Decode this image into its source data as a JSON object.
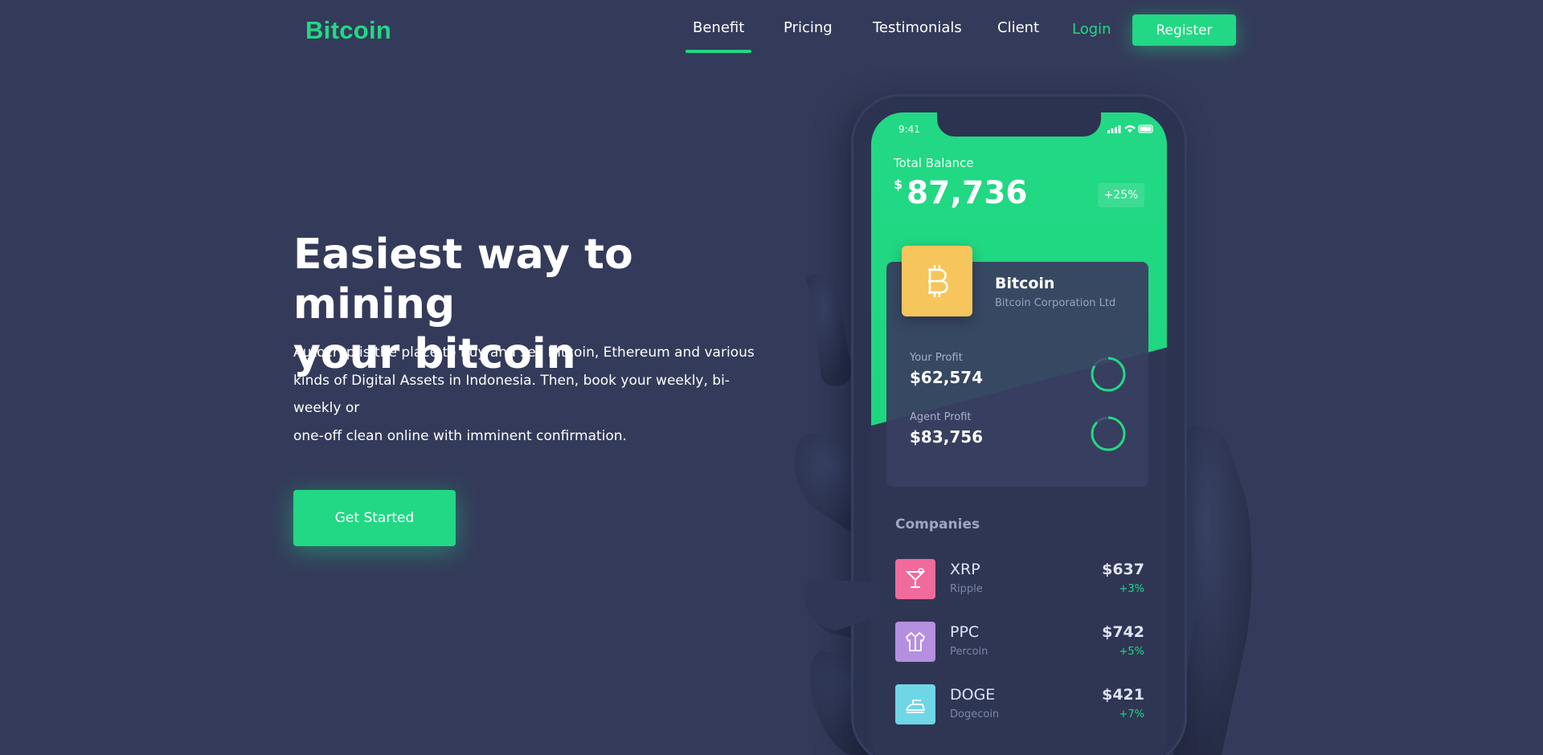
{
  "brand": {
    "logo_text": "Bitcoin",
    "accent": "#22d884",
    "background": "#343b5a"
  },
  "nav": {
    "links": [
      {
        "label": "Benefit",
        "active": true
      },
      {
        "label": "Pricing",
        "active": false
      },
      {
        "label": "Testimonials",
        "active": false
      },
      {
        "label": "Client",
        "active": false
      }
    ],
    "login_label": "Login",
    "register_label": "Register"
  },
  "hero": {
    "title_line1": "Easiest way to mining",
    "title_line2": "your bitcoin",
    "description_line1": "Autocryp is the place to buy and sell Bitcoin, Ethereum and various",
    "description_line2": "kinds of Digital Assets in Indonesia. Then, book your weekly, bi-weekly or",
    "description_line3": "one-off clean online with imminent confirmation.",
    "cta_label": "Get Started"
  },
  "phone": {
    "status_time": "9:41",
    "total_balance_label": "Total Balance",
    "currency_symbol": "$",
    "total_balance_value": "87,736",
    "balance_change": "+25%",
    "coin": {
      "name": "Bitcoin",
      "company": "Bitcoin Corporation Ltd",
      "icon": "bitcoin-icon",
      "color": "#f6c55b"
    },
    "profits": [
      {
        "label": "Your Profit",
        "value": "$62,574"
      },
      {
        "label": "Agent Profit",
        "value": "$83,756"
      }
    ],
    "companies_title": "Companies",
    "companies": [
      {
        "symbol": "XRP",
        "name": "Ripple",
        "price": "$637",
        "change": "+3%",
        "icon": "cocktail-icon",
        "color": "#f06a9b"
      },
      {
        "symbol": "PPC",
        "name": "Percoin",
        "price": "$742",
        "change": "+5%",
        "icon": "jacket-icon",
        "color": "#b58fe0"
      },
      {
        "symbol": "DOGE",
        "name": "Dogecoin",
        "price": "$421",
        "change": "+7%",
        "icon": "iron-icon",
        "color": "#6fd6e6"
      }
    ]
  }
}
